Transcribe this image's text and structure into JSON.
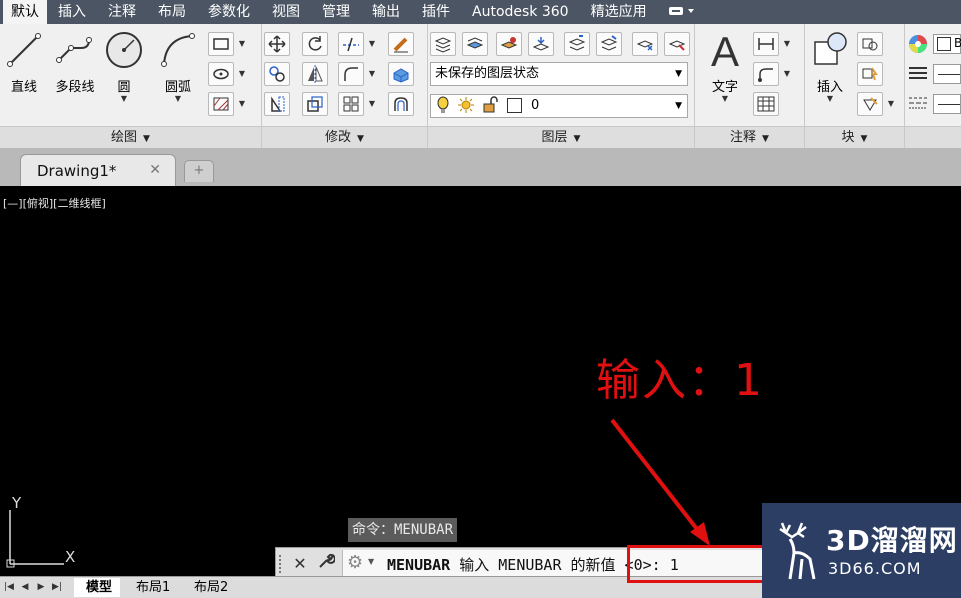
{
  "menu": {
    "tabs": [
      "默认",
      "插入",
      "注释",
      "布局",
      "参数化",
      "视图",
      "管理",
      "输出",
      "插件",
      "Autodesk 360",
      "精选应用"
    ],
    "active_index": 0
  },
  "ribbon": {
    "draw": {
      "line": "直线",
      "polyline": "多段线",
      "circle": "圆",
      "arc": "圆弧",
      "footer": "绘图"
    },
    "modify": {
      "footer": "修改"
    },
    "layers": {
      "state_combo": "未保存的图层状态",
      "layer_combo": "0",
      "footer": "图层"
    },
    "annotation": {
      "text": "文字",
      "footer": "注释"
    },
    "block": {
      "insert": "插入",
      "footer": "块"
    },
    "properties": {
      "partial_label": "B"
    }
  },
  "doc": {
    "tab_name": "Drawing1*",
    "close_glyph": "✕",
    "new_tab_glyph": "+"
  },
  "viewport": {
    "label": "[—][俯视][二维线框]",
    "annotation": "输入：1",
    "annotation_color": "#e01010"
  },
  "ucs": {
    "x": "X",
    "y": "Y"
  },
  "command": {
    "tooltip": "命令：MENUBAR",
    "prompt_cmd": "MENUBAR",
    "prompt_text": "输入 MENUBAR 的新值 <0>: 1"
  },
  "layouts": {
    "tabs": [
      "模型",
      "布局1",
      "布局2"
    ],
    "active_index": 0
  },
  "watermark": {
    "title": "3D溜溜网",
    "subtitle": "3D66.COM"
  }
}
